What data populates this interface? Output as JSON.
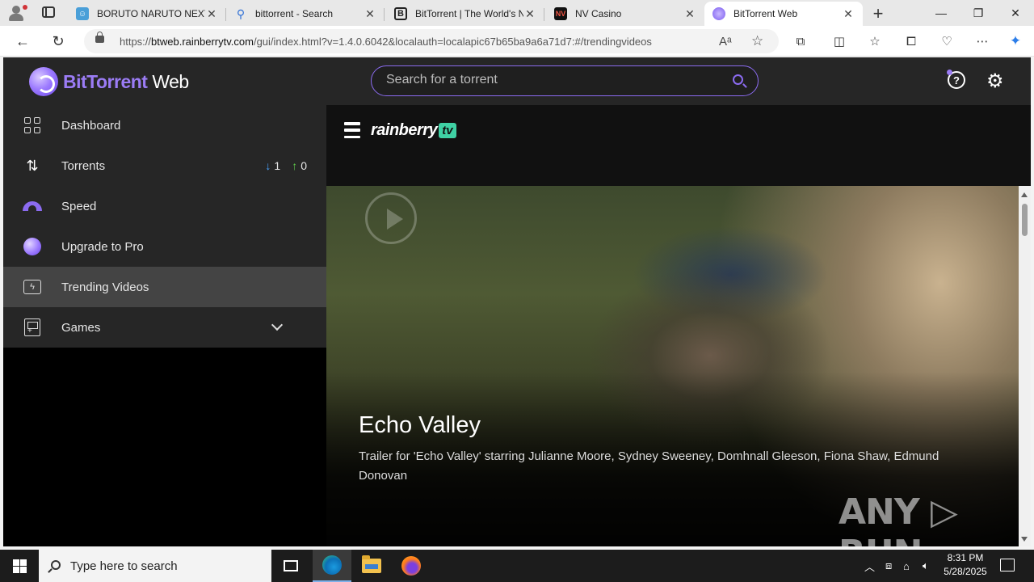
{
  "browser": {
    "tabs": [
      {
        "title": "BORUTO NARUTO NEXT G",
        "favicon": "boruto-icon",
        "active": false
      },
      {
        "title": "bittorrent - Search",
        "favicon": "search-icon",
        "active": false
      },
      {
        "title": "BitTorrent | The World's N",
        "favicon": "bittorrent-b-icon",
        "active": false
      },
      {
        "title": "NV Casino",
        "favicon": "nv-icon",
        "active": false
      },
      {
        "title": "BitTorrent Web",
        "favicon": "bittorrent-web-icon",
        "active": true
      }
    ],
    "new_tab_label": "+",
    "url_prefix": "https://",
    "url_host": "btweb.rainberrytv.com",
    "url_rest": "/gui/index.html?v=1.4.0.6042&localauth=localapic67b65ba9a6a71d7:#/trendingvideos"
  },
  "app": {
    "logo_brand": "BitTorrent",
    "logo_suffix": " Web",
    "search_placeholder": "Search for a torrent",
    "accent_color": "#8b6bf0"
  },
  "sidebar": {
    "items": [
      {
        "label": "Dashboard",
        "icon": "dashboard-grid-icon"
      },
      {
        "label": "Torrents",
        "icon": "torrents-arrows-icon",
        "down_count": "1",
        "up_count": "0"
      },
      {
        "label": "Speed",
        "icon": "speedometer-icon"
      },
      {
        "label": "Upgrade to Pro",
        "icon": "pro-logo-icon"
      },
      {
        "label": "Trending Videos",
        "icon": "trending-video-icon",
        "active": true
      },
      {
        "label": "Games",
        "icon": "gameboy-icon"
      }
    ]
  },
  "content": {
    "brand": "rainberry",
    "brand_tv": "tv",
    "video_title": "Echo Valley",
    "video_description": "Trailer for 'Echo Valley' starring Julianne Moore, Sydney Sweeney, Domhnall Gleeson, Fiona Shaw, Edmund Donovan",
    "watermark": "ANY ▷ RUN"
  },
  "taskbar": {
    "search_placeholder": "Type here to search",
    "time": "8:31 PM",
    "date": "5/28/2025"
  }
}
